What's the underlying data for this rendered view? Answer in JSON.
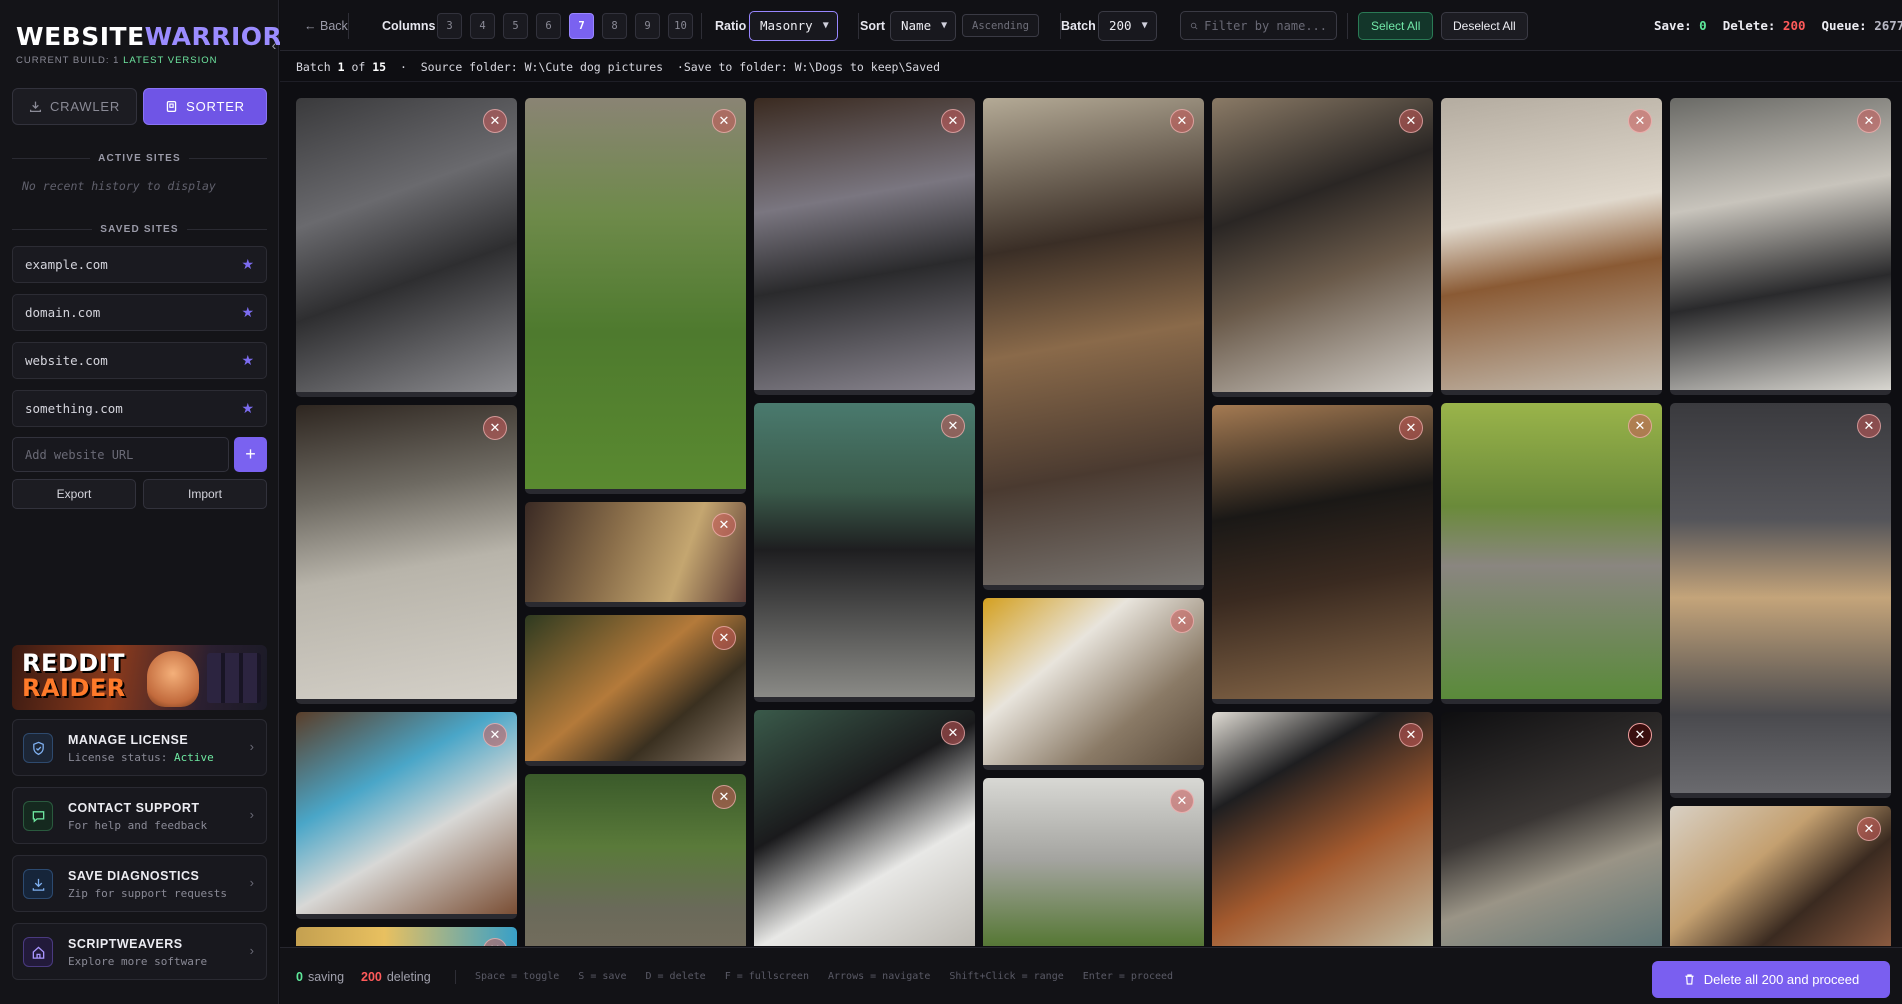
{
  "sidebar": {
    "logo_part1": "WEBSITE",
    "logo_part2": "WARRIOR",
    "build_label": "CURRENT BUILD: 1",
    "build_status": "LATEST VERSION",
    "crawler_label": "CRAWLER",
    "sorter_label": "SORTER",
    "active_sites_label": "ACTIVE SITES",
    "no_history": "No recent history to display",
    "saved_sites_label": "SAVED SITES",
    "saved_sites": [
      "example.com",
      "domain.com",
      "website.com",
      "something.com"
    ],
    "add_url_placeholder": "Add website URL",
    "export_label": "Export",
    "import_label": "Import",
    "banner_line1": "REDDIT",
    "banner_line2": "RAIDER",
    "menu": [
      {
        "title": "MANAGE LICENSE",
        "sub_prefix": "License status: ",
        "sub_value": "Active"
      },
      {
        "title": "CONTACT SUPPORT",
        "sub": "For help and feedback"
      },
      {
        "title": "SAVE DIAGNOSTICS",
        "sub": "Zip for support requests"
      },
      {
        "title": "SCRIPTWEAVERS",
        "sub": "Explore more software"
      }
    ]
  },
  "toolbar": {
    "back_label": "Back",
    "columns_label": "Columns",
    "columns": [
      "3",
      "4",
      "5",
      "6",
      "7",
      "8",
      "9",
      "10"
    ],
    "selected_columns": "7",
    "ratio_label": "Ratio",
    "ratio_value": "Masonry",
    "sort_label": "Sort",
    "sort_value": "Name",
    "order_label": "Ascending",
    "batch_label": "Batch",
    "batch_value": "200",
    "filter_placeholder": "Filter by name...",
    "select_all_label": "Select All",
    "deselect_all_label": "Deselect All",
    "save_label": "Save:",
    "save_count": "0",
    "delete_label": "Delete:",
    "delete_count": "200",
    "queue_label": "Queue:",
    "queue_count": "2677"
  },
  "infobar": {
    "batch_word": "Batch",
    "batch_current": "1",
    "of_word": "of",
    "batch_total": "15",
    "source_text": "Source folder: W:\\Cute dog pictures",
    "save_text": "Save to folder: W:\\Dogs to keep\\Saved"
  },
  "footer": {
    "saving_count": "0",
    "saving_label": "saving",
    "deleting_count": "200",
    "deleting_label": "deleting",
    "hints": [
      "Space = toggle",
      "S = save",
      "D = delete",
      "F = fullscreen",
      "Arrows = navigate",
      "Shift+Click = range",
      "Enter = proceed"
    ],
    "delete_all_label": "Delete all 200 and proceed"
  },
  "colors": {
    "accent": "#7a62f0",
    "save_green": "#5ee89a",
    "delete_red": "#ff5a5a",
    "background": "#0e0e12"
  }
}
